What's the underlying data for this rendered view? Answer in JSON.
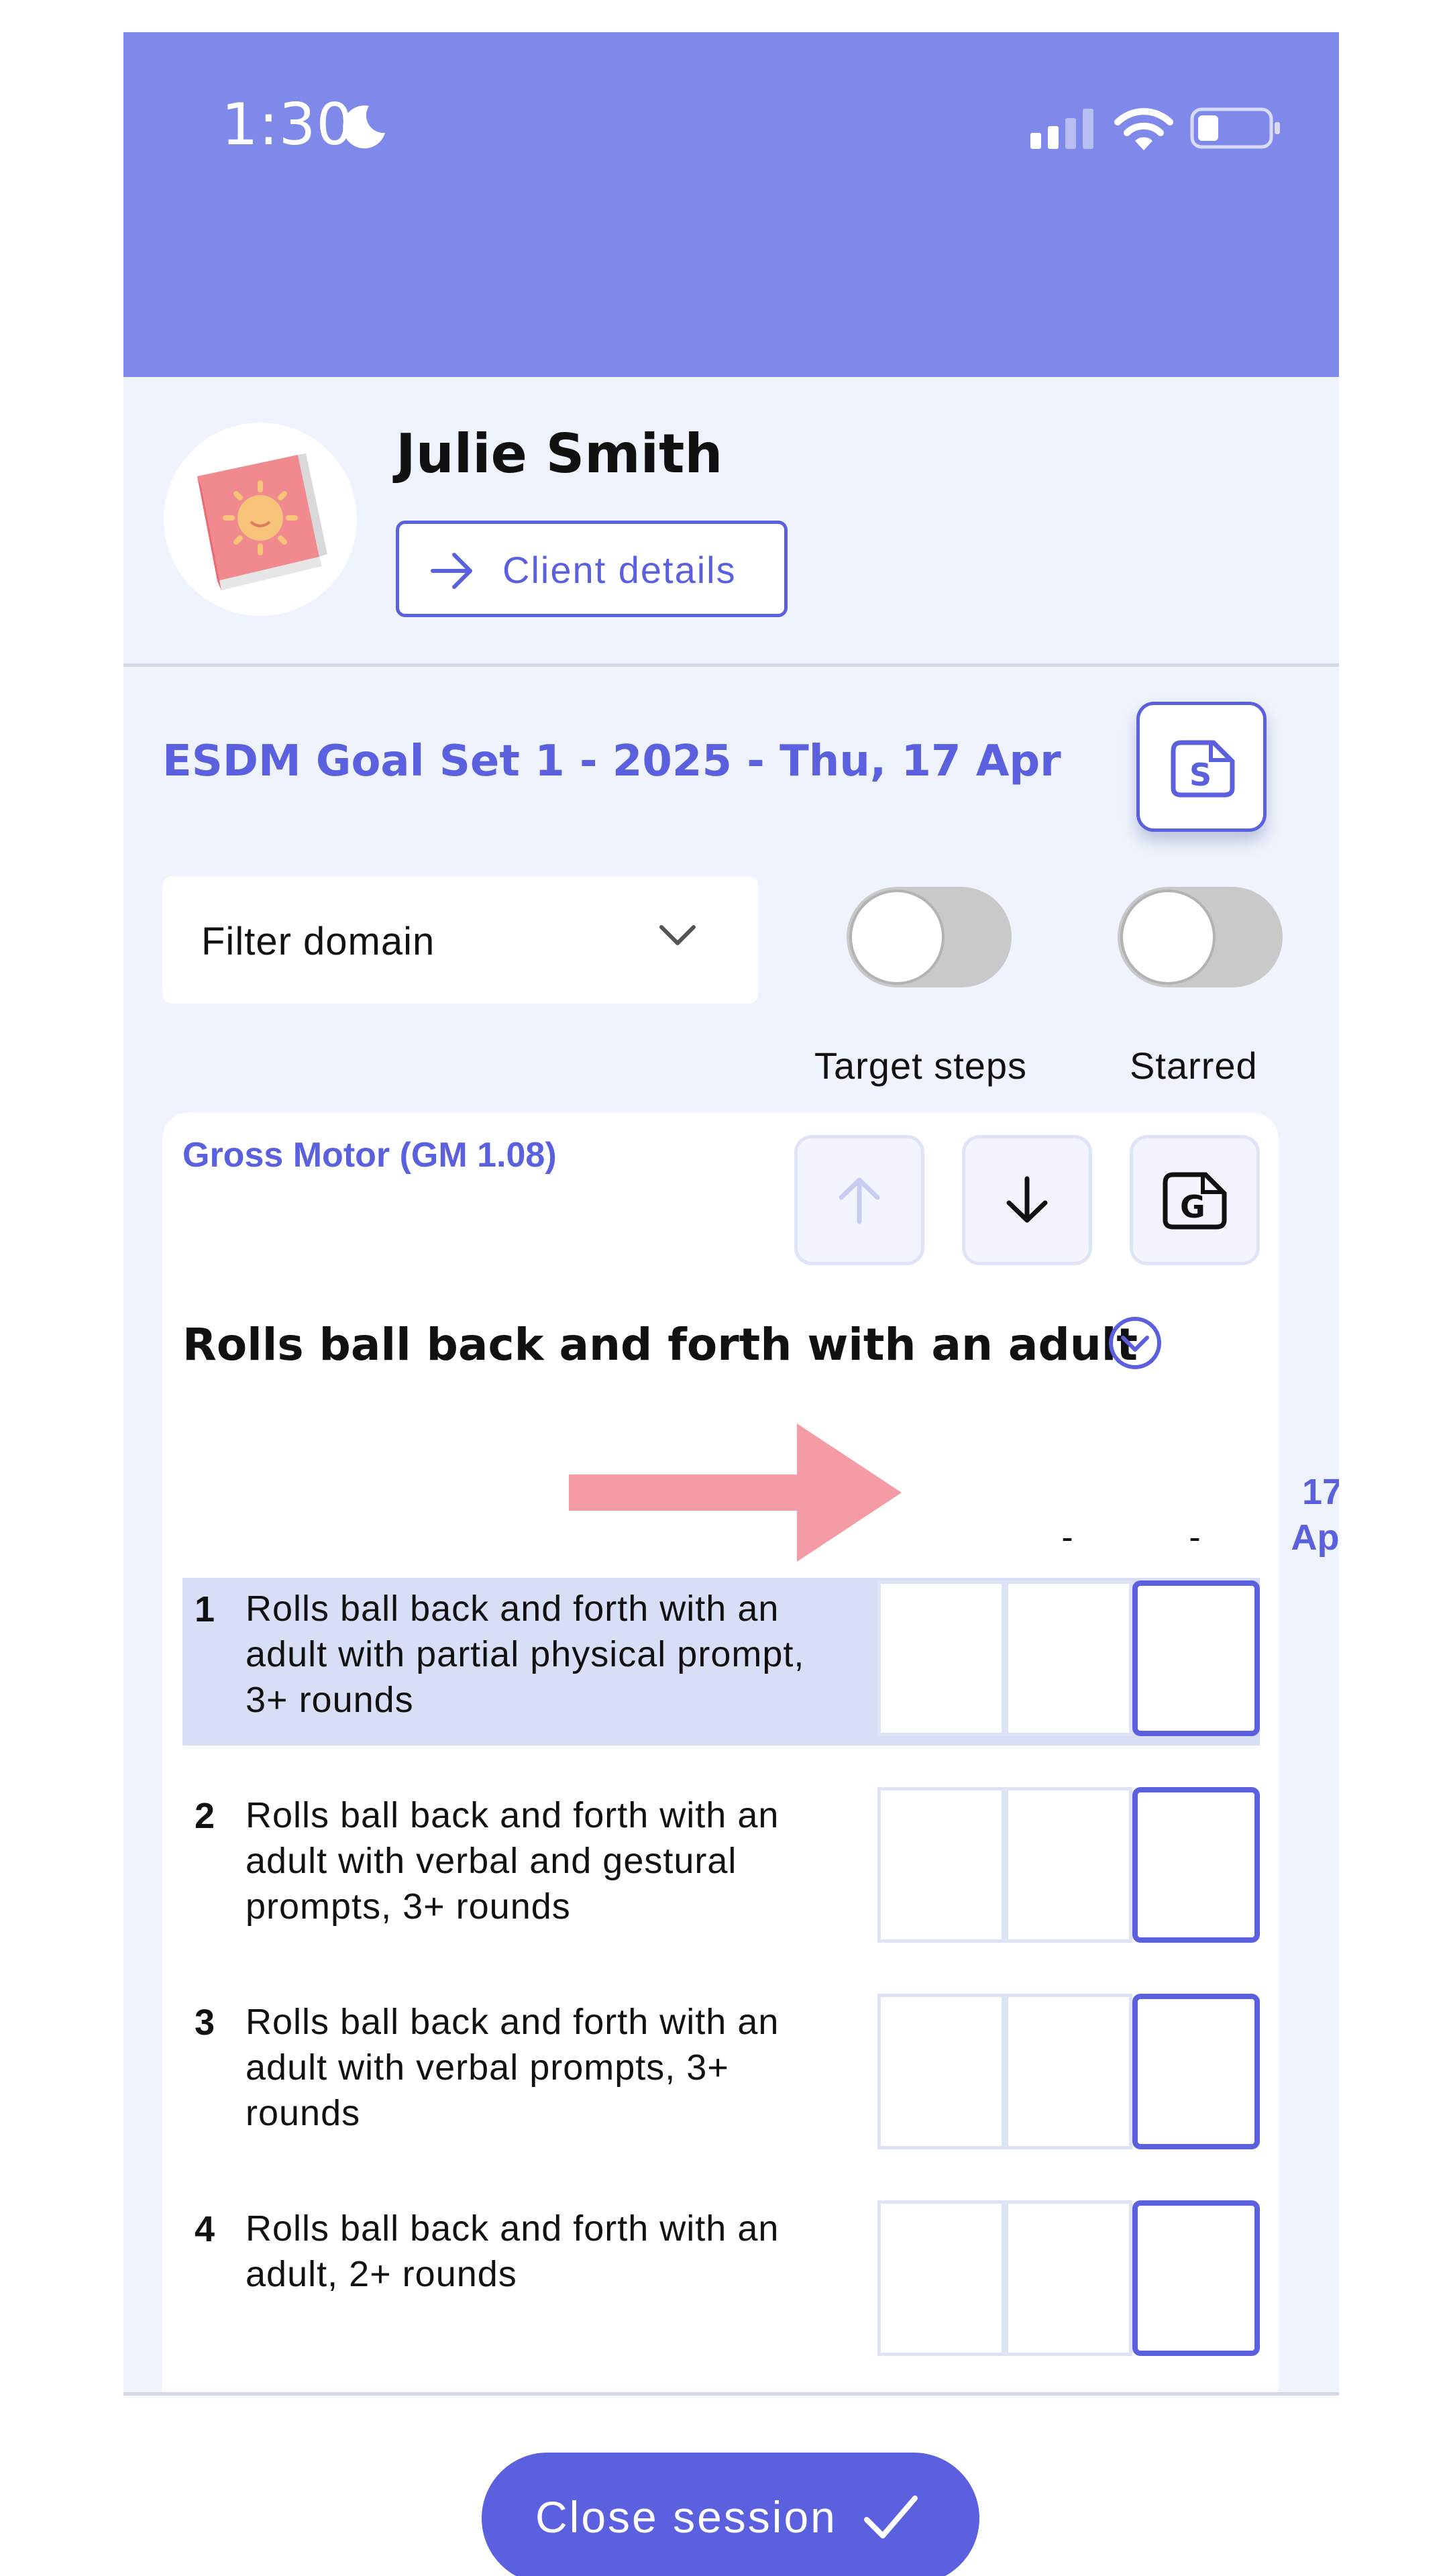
{
  "status_bar": {
    "time": "1:30"
  },
  "client": {
    "name": "Julie Smith",
    "details_button": "Client details"
  },
  "session": {
    "title": "ESDM Goal Set 1 - 2025 - Thu, 17 Apr",
    "s_badge": "S"
  },
  "filters": {
    "domain_placeholder": "Filter domain",
    "target_steps_label": "Target steps",
    "starred_label": "Starred",
    "target_steps_on": false,
    "starred_on": false
  },
  "goal": {
    "domain": "Gross Motor (GM 1.08)",
    "g_badge": "G",
    "title": "Rolls ball back and forth with an adult",
    "columns": [
      {
        "line1": "-",
        "line2": ""
      },
      {
        "line1": "-",
        "line2": ""
      },
      {
        "line1": "17",
        "line2": "Apr"
      }
    ],
    "steps": [
      {
        "num": "1",
        "text": "Rolls ball back and forth with an adult with partial physical prompt, 3+ rounds",
        "selected": true
      },
      {
        "num": "2",
        "text": "Rolls ball back and forth with an adult with verbal and gestural prompts, 3+ rounds",
        "selected": false
      },
      {
        "num": "3",
        "text": "Rolls ball back and forth with an adult with verbal prompts, 3+ rounds",
        "selected": false
      },
      {
        "num": "4",
        "text": "Rolls ball back and forth with an adult, 2+ rounds",
        "selected": false
      }
    ]
  },
  "footer": {
    "close_label": "Close session"
  },
  "colors": {
    "header": "#7f89e9",
    "accent": "#5b61de",
    "background": "#eef3fd",
    "selected_row": "#d9def7",
    "arrow": "#f49ba5"
  }
}
